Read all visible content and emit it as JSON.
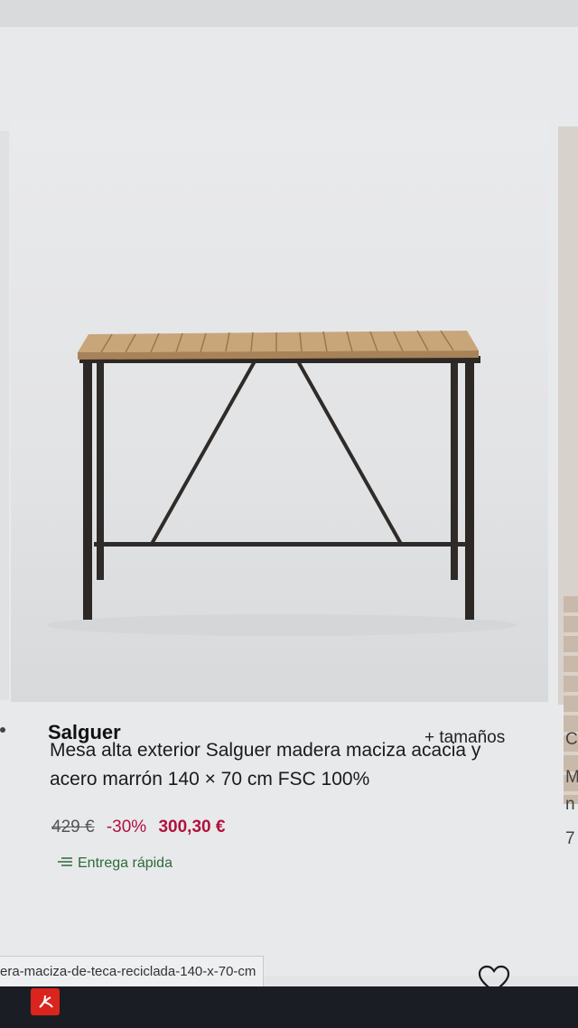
{
  "product": {
    "brand": "Salguer",
    "sizes_link": "+ tamaños",
    "title": "Mesa alta exterior Salguer madera maciza acacia y acero marrón 140 × 70 cm FSC 100%",
    "old_price": "429 €",
    "discount": "-30%",
    "new_price": "300,30 €",
    "delivery": "Entrega rápida"
  },
  "next_card": {
    "letters": [
      "C",
      "M",
      "n",
      "7"
    ]
  },
  "status_url": "era-maciza-de-teca-reciclada-140-x-70-cm",
  "icons": {
    "favorite": "heart-icon",
    "delivery": "delivery-lines-icon",
    "taskbar_app": "pdf-icon"
  },
  "colors": {
    "price_accent": "#b0123e",
    "delivery_green": "#2d6a3a"
  }
}
